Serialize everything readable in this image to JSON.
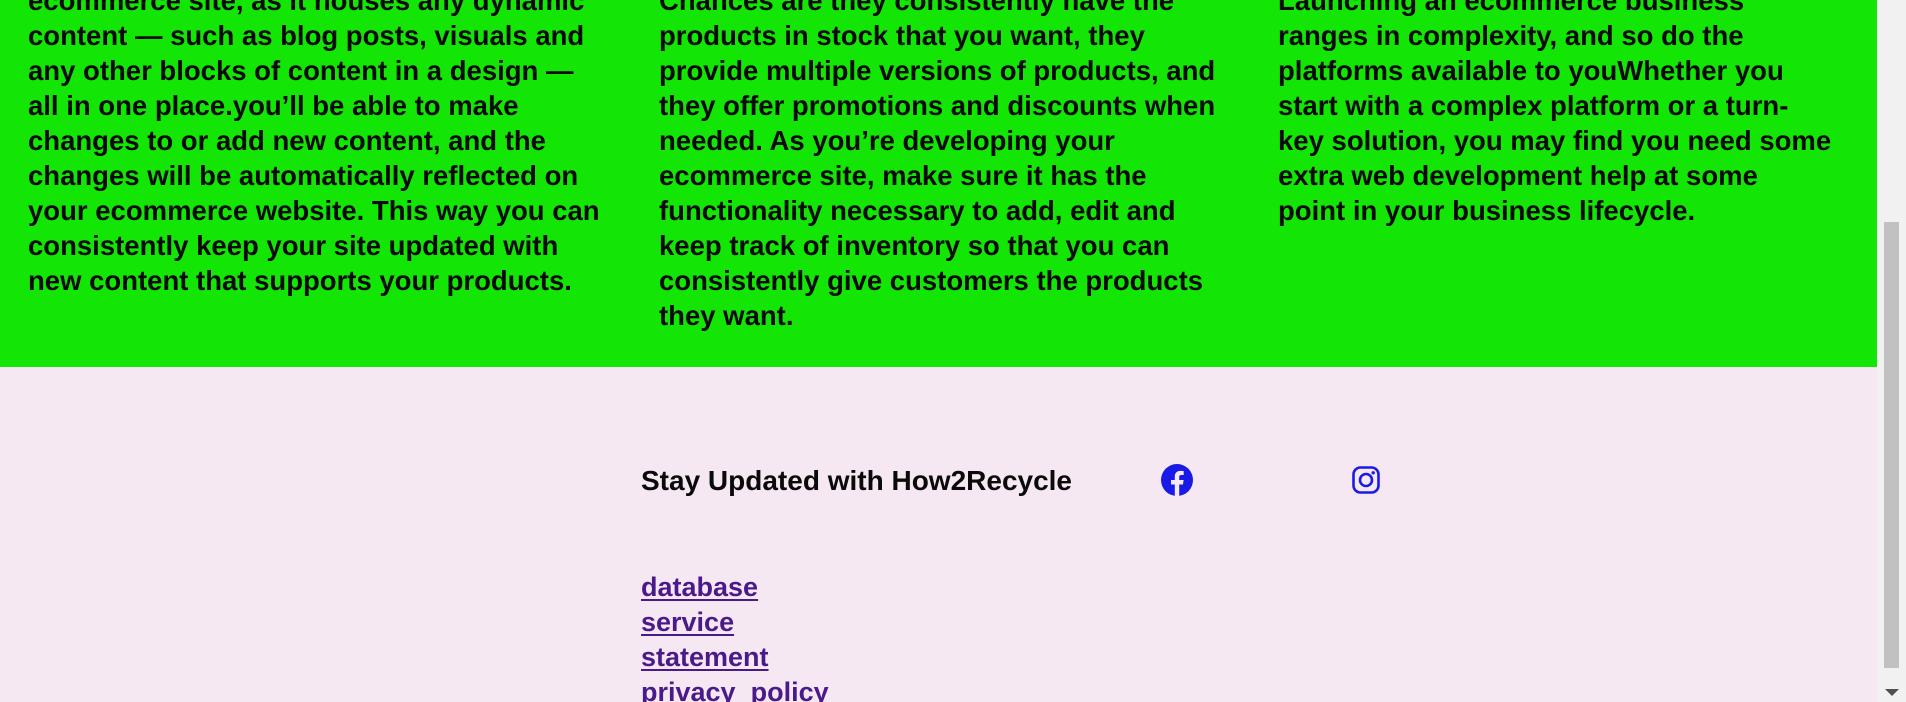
{
  "columns": [
    {
      "lines": [
        "ecommerce site, as it houses any dynamic",
        "content — such as blog posts, visuals and",
        "any other blocks of content in a design —",
        "all in one place.you’ll be able to make",
        "changes to or add new content, and the",
        "changes will be automatically reflected on",
        "your ecommerce website. This way you can",
        "consistently keep your site updated with",
        "new content that supports your products."
      ]
    },
    {
      "lines": [
        "Chances are they consistently have the",
        "products in stock that you want, they",
        "provide multiple versions of products, and",
        "they offer promotions and discounts when",
        "needed. As you’re developing your",
        "ecommerce site, make sure it has the",
        "functionality necessary to add, edit and",
        "keep track of inventory so that you can",
        "consistently give customers the products",
        "they want."
      ]
    },
    {
      "lines": [
        "Launching an ecommerce business",
        "ranges in complexity, and so do the",
        "platforms available to youWhether you",
        "start with a complex platform or a turn-",
        "key solution, you may find you need some",
        "extra web development help at some",
        "point in your business lifecycle."
      ]
    }
  ],
  "footer": {
    "title": "Stay Updated with How2Recycle",
    "social": [
      {
        "icon": "facebook-icon",
        "color": "#1a1ae6"
      },
      {
        "icon": "instagram-icon",
        "color": "#1a1ae6"
      }
    ],
    "links": [
      "database",
      "service",
      "statement",
      "privacy_policy"
    ]
  },
  "colors": {
    "green_band": "#13e605",
    "footer_bg": "#f5e8f2",
    "link": "#4a1a8a",
    "text": "#0a0a0a"
  }
}
